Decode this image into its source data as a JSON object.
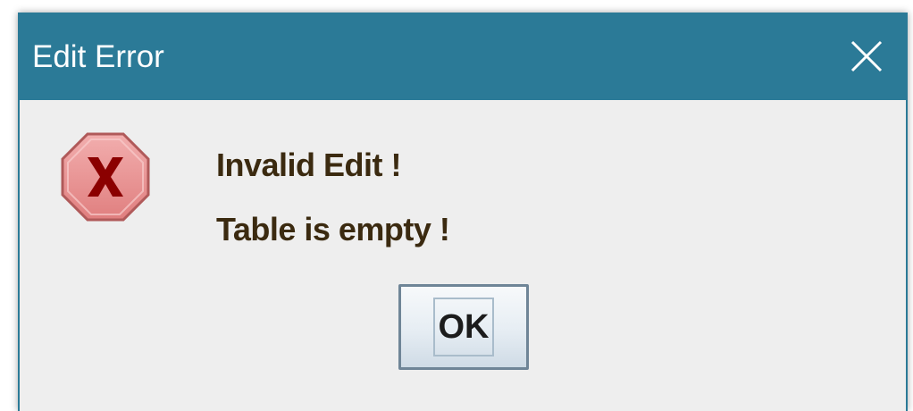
{
  "window": {
    "title": "Edit Error"
  },
  "icons": {
    "close": "close-icon",
    "error": "error-icon"
  },
  "message": {
    "line1": "Invalid Edit !",
    "line2": "Table is empty !"
  },
  "buttons": {
    "ok_label": "OK"
  },
  "colors": {
    "titlebar": "#2b7a97",
    "dialog_background": "#eeeeee",
    "message_text": "#3b2a10",
    "error_icon_fill": "#e58c8c",
    "error_icon_x": "#8b0000"
  }
}
